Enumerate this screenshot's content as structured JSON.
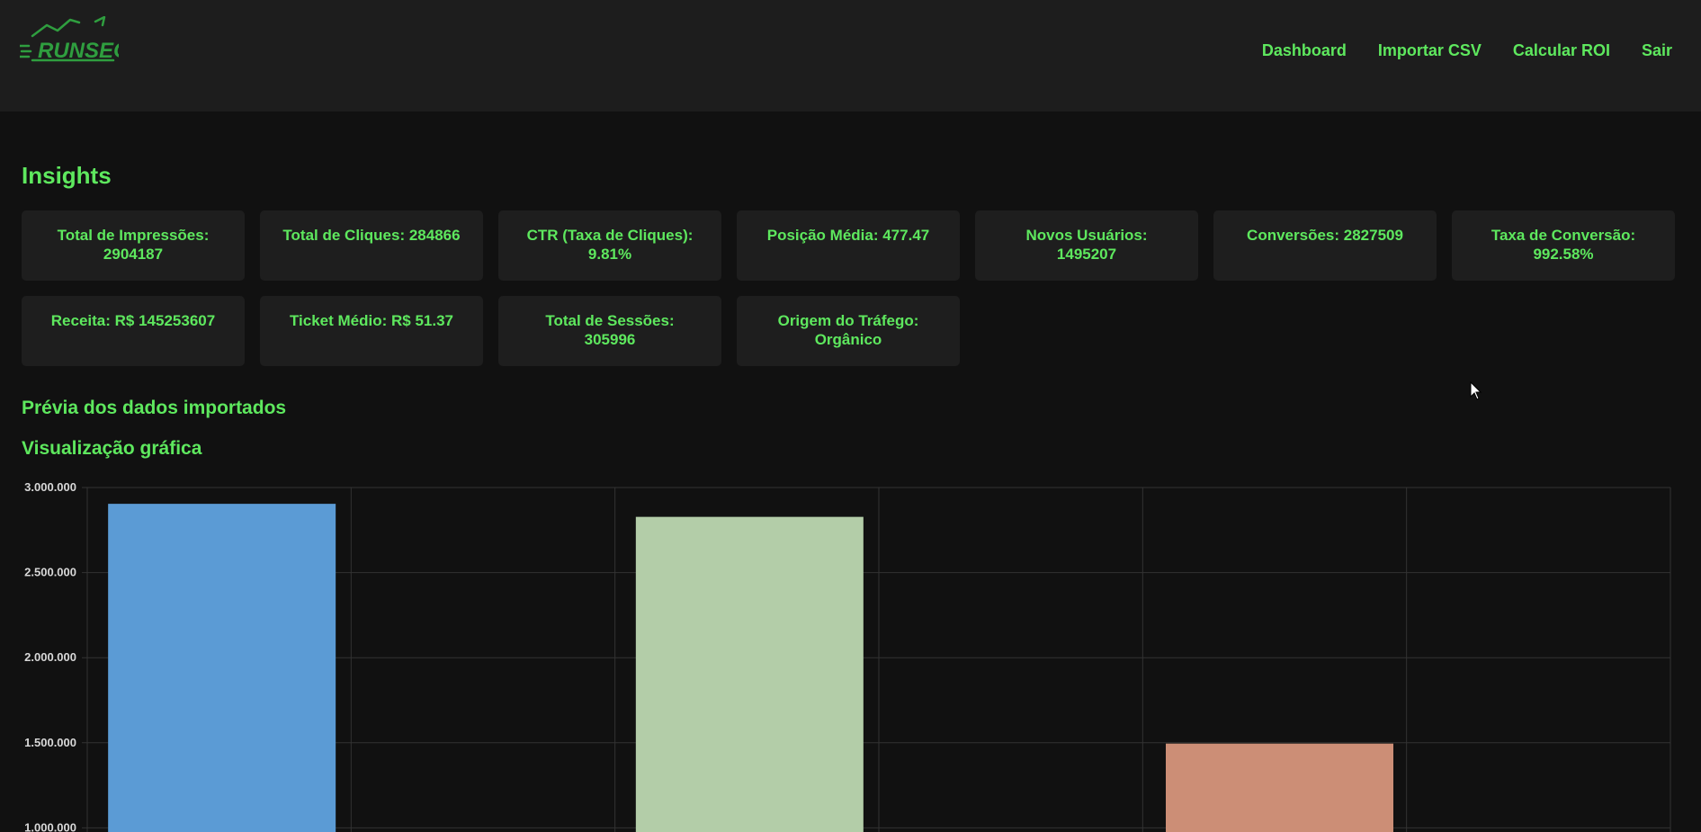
{
  "brand": {
    "logo_text": "RUNSEO",
    "accent_color": "#2f9e3f"
  },
  "nav": {
    "items": [
      {
        "label": "Dashboard"
      },
      {
        "label": "Importar CSV"
      },
      {
        "label": "Calcular ROI"
      },
      {
        "label": "Sair"
      }
    ]
  },
  "insights": {
    "title": "Insights",
    "cards": [
      {
        "line1": "Total de Impressões:",
        "line2": "2904187"
      },
      {
        "line1": "Total de Cliques: 284866",
        "line2": ""
      },
      {
        "line1": "CTR (Taxa de Cliques):",
        "line2": "9.81%"
      },
      {
        "line1": "Posição Média: 477.47",
        "line2": ""
      },
      {
        "line1": "Novos Usuários:",
        "line2": "1495207"
      },
      {
        "line1": "Conversões: 2827509",
        "line2": ""
      },
      {
        "line1": "Taxa de Conversão:",
        "line2": "992.58%"
      },
      {
        "line1": "Receita: R$ 145253607",
        "line2": ""
      },
      {
        "line1": "Ticket Médio: R$ 51.37",
        "line2": ""
      },
      {
        "line1": "Total de Sessões:",
        "line2": "305996"
      },
      {
        "line1": "Origem do Tráfego:",
        "line2": "Orgânico"
      }
    ]
  },
  "preview": {
    "title": "Prévia dos dados importados"
  },
  "chart_section": {
    "title": "Visualização gráfica"
  },
  "chart_data": {
    "type": "bar",
    "values": [
      2904187,
      2827509,
      1495207
    ],
    "colors": [
      "#5b9bd5",
      "#b3cda8",
      "#cc8e76"
    ],
    "ylim": [
      1000000,
      3000000
    ],
    "yticks": [
      {
        "value": 3000000,
        "label": "3.000.000"
      },
      {
        "value": 2500000,
        "label": "2.500.000"
      },
      {
        "value": 2000000,
        "label": "2.000.000"
      },
      {
        "value": 1500000,
        "label": "1.500.000"
      },
      {
        "value": 1000000,
        "label": "1.000.000"
      }
    ],
    "grid": true
  }
}
